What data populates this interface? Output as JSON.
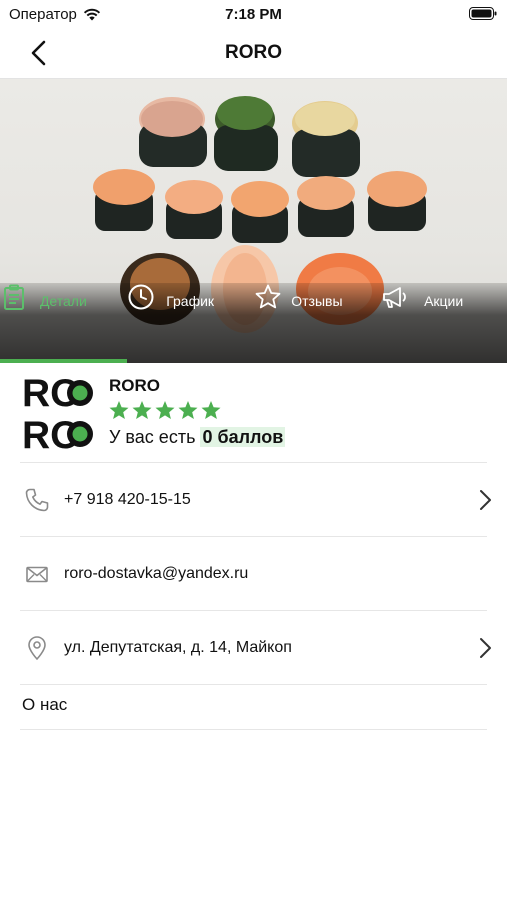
{
  "status_bar": {
    "carrier": "Оператор",
    "time": "7:18 PM"
  },
  "nav": {
    "title": "RORO"
  },
  "tabs": [
    {
      "label": "Детали",
      "icon": "clipboard-icon",
      "active": true
    },
    {
      "label": "График",
      "icon": "clock-icon",
      "active": false
    },
    {
      "label": "Отзывы",
      "icon": "star-outline-icon",
      "active": false
    },
    {
      "label": "Акции",
      "icon": "megaphone-icon",
      "active": false
    }
  ],
  "restaurant": {
    "logo_text": [
      "RO",
      "RO"
    ],
    "name": "RORO",
    "rating": 5,
    "points_prefix": "У вас есть ",
    "points_value": "0 баллов"
  },
  "contacts": {
    "phone": "+7 918 420-15-15",
    "email": "roro-dostavka@yandex.ru",
    "address": "ул. Депутатская, д. 14, Майкоп"
  },
  "about_label": "О нас",
  "colors": {
    "accent": "#4caf50",
    "points_bg": "#e2f4e4"
  }
}
